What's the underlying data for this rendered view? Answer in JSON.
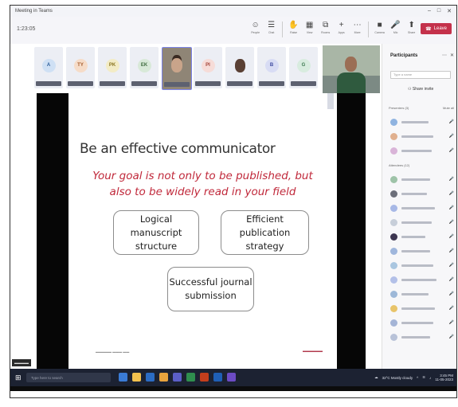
{
  "window": {
    "title": "Meeting in Teams"
  },
  "toolbar": {
    "meeting_time": "1:23:05",
    "buttons": [
      {
        "icon": "participants-icon",
        "glyph": "☺",
        "label": "People"
      },
      {
        "icon": "chat-icon",
        "glyph": "☰",
        "label": "Chat"
      },
      {
        "icon": "raise-hand-icon",
        "glyph": "✋",
        "label": "Raise"
      },
      {
        "icon": "view-icon",
        "glyph": "▦",
        "label": "View"
      },
      {
        "icon": "rooms-icon",
        "glyph": "⧉",
        "label": "Rooms"
      },
      {
        "icon": "apps-icon",
        "glyph": "+",
        "label": "Apps"
      },
      {
        "icon": "more-icon",
        "glyph": "⋯",
        "label": "More"
      },
      {
        "icon": "camera-icon",
        "glyph": "■",
        "label": "Camera"
      },
      {
        "icon": "mic-icon",
        "glyph": "🎤",
        "label": "Mic"
      },
      {
        "icon": "share-icon",
        "glyph": "⬆",
        "label": "Share"
      }
    ],
    "leave_label": "Leave"
  },
  "participant_tiles": [
    {
      "initials": "A",
      "bg": "#cfe0f4",
      "fg": "#2d5d9a"
    },
    {
      "initials": "TY",
      "bg": "#f6dcc8",
      "fg": "#a45a2a"
    },
    {
      "initials": "PK",
      "bg": "#f3ecc6",
      "fg": "#8a7520"
    },
    {
      "initials": "EK",
      "bg": "#d8e9d8",
      "fg": "#3e6b3e"
    },
    {
      "initials": "",
      "type": "video"
    },
    {
      "initials": "PI",
      "bg": "#f6dcd8",
      "fg": "#a34036"
    },
    {
      "initials": "",
      "type": "photo"
    },
    {
      "initials": "B",
      "bg": "#d8dcf4",
      "fg": "#3d4aa0"
    },
    {
      "initials": "G",
      "bg": "#d8ecdf",
      "fg": "#3e7a52"
    }
  ],
  "slide": {
    "heading": "Be an effective communicator",
    "goal_line1": "Your goal is not only to be published, but",
    "goal_line2": "also to be widely read in your field",
    "box1": "Logical manuscript\nstructure",
    "box2": "Efficient publication\nstrategy",
    "box3": "Successful journal\nsubmission"
  },
  "participants_panel": {
    "title": "Participants",
    "search_placeholder": "Type a name",
    "share_invite": "Share invite",
    "presenters_header": "Presenters (3)",
    "mute_all": "Mute all",
    "attendees_header": "Attendees (12)"
  },
  "taskbar": {
    "search_placeholder": "Type here to search",
    "weather": "32°C Mostly cloudy",
    "time": "3:45 PM",
    "date": "11-05-2023"
  }
}
